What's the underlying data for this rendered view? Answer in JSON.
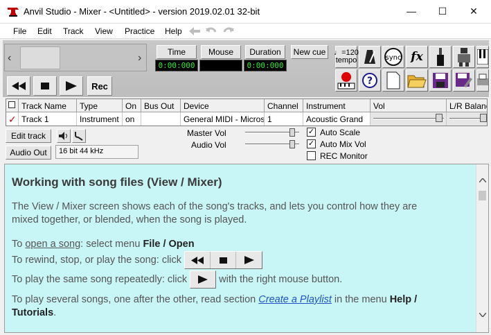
{
  "window": {
    "title": "Anvil Studio - Mixer - <Untitled> - version 2019.02.01 32-bit",
    "minimize": "—",
    "maximize": "☐",
    "close": "✕"
  },
  "menu": [
    "File",
    "Edit",
    "Track",
    "View",
    "Practice",
    "Help"
  ],
  "toolbar": {
    "time_label": "Time",
    "time_value": "0:00:000",
    "mouse_label": "Mouse",
    "mouse_value": "",
    "duration_label": "Duration",
    "duration_value": "0:00:000",
    "newcue_label": "New cue",
    "tempo_value": "♩=120",
    "tempo_label": "tempo",
    "sync_label": "sync",
    "fx_label": "fx",
    "rec_label": "Rec",
    "nav_left": "‹",
    "nav_right": "›"
  },
  "tracks": {
    "headers": [
      "Track Name",
      "Type",
      "On",
      "Bus Out",
      "Device",
      "Channel",
      "Instrument",
      "Vol",
      "L/R Balance"
    ],
    "rows": [
      {
        "name": "Track 1",
        "type": "Instrument",
        "on": "on",
        "bus_out": "",
        "device": "General MIDI - Microsoft GS Wavetable Synth",
        "channel": "1",
        "instrument": "Acoustic Grand"
      }
    ]
  },
  "controls": {
    "edit_track": "Edit track",
    "audio_out": "Audio Out",
    "audio_format": "16 bit 44 kHz",
    "master_vol": "Master Vol",
    "audio_vol": "Audio Vol",
    "auto_scale": "Auto Scale",
    "auto_mix_vol": "Auto Mix Vol",
    "rec_monitor": "REC Monitor",
    "check_mark": "✓"
  },
  "help": {
    "title": "Working with song files (View / Mixer)",
    "p1a": "The View / Mixer screen shows each of the song's tracks, and lets you control how they are",
    "p1b": "mixed together, or blended, when the song is played.",
    "p2_pre": "To ",
    "p2_link": "open a song",
    "p2_mid": ": select menu ",
    "p2_bold": "File / Open",
    "p3": "To rewind, stop, or play the song: click",
    "p4_pre": "To play the same song repeatedly: click",
    "p4_post": "with the right mouse button.",
    "p5_pre": "To play several songs, one after the other, read section ",
    "p5_link": "Create a Playlist",
    "p5_mid": " in the menu ",
    "p5_bold1": "Help /",
    "p5_bold2": "Tutorials",
    "p5_end": "."
  },
  "colors": {
    "lcd_text": "#2ee82e",
    "help_bg": "#c8f5f5",
    "link": "#1f55c8",
    "rec_red": "#e00000"
  }
}
